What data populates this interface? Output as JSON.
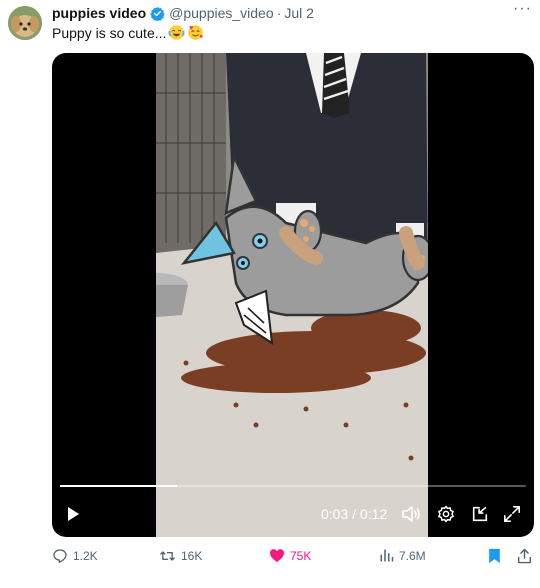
{
  "post": {
    "display_name": "puppies video",
    "handle": "@puppies_video",
    "separator": "·",
    "date": "Jul 2",
    "text": "Puppy is so cute...",
    "emojis": [
      "tears-of-joy-emoji",
      "smiling-face-with-hearts-emoji"
    ],
    "more_label": "···"
  },
  "video": {
    "current_time": "0:03",
    "duration": "0:12",
    "time_display": "0:03 / 0:12",
    "progress": 0.25
  },
  "actions": {
    "replies": "1.2K",
    "reposts": "16K",
    "likes": "75K",
    "views": "7.6M"
  },
  "colors": {
    "accent": "#1d9bf0",
    "like": "#f91880",
    "text": "#0f1419",
    "muted": "#536471"
  }
}
